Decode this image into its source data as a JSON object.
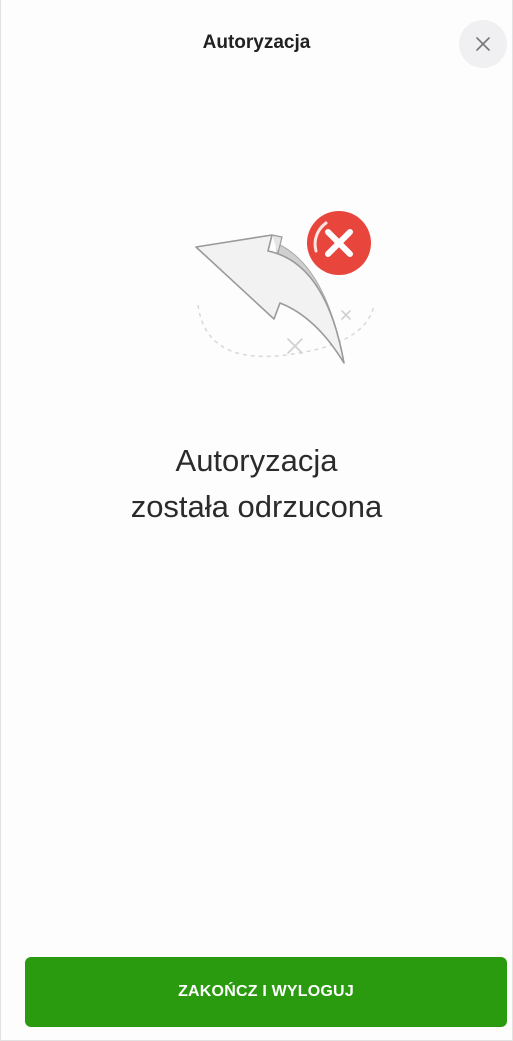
{
  "header": {
    "title": "Autoryzacja",
    "close_icon": "close-icon"
  },
  "illustration": {
    "icon": "rejected-arrow-icon",
    "badge_icon": "error-x-icon",
    "badge_color": "#e8453c"
  },
  "message": {
    "line1": "Autoryzacja",
    "line2": "została odrzucona"
  },
  "footer": {
    "primary_button_label": "ZAKOŃCZ I WYLOGUJ",
    "primary_button_color": "#2a9a0e"
  }
}
